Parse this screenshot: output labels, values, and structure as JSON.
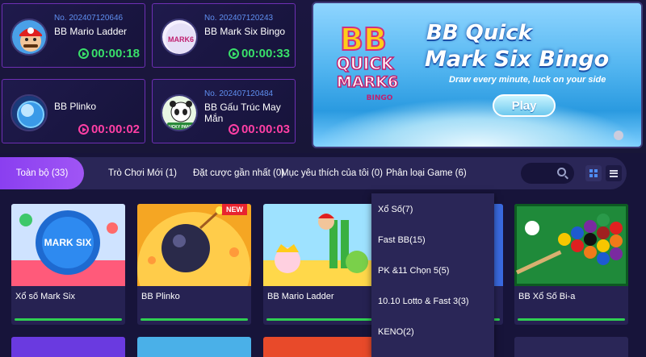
{
  "draws": [
    {
      "no": "No. 202407120646",
      "name": "BB Mario Ladder",
      "timer": "00:00:18",
      "status": "green"
    },
    {
      "no": "No. 202407120243",
      "name": "BB Mark Six Bingo",
      "timer": "00:00:33",
      "status": "green"
    },
    {
      "no": "",
      "name": "BB Plinko",
      "timer": "00:00:02",
      "status": "pink"
    },
    {
      "no": "No. 202407120484",
      "name": "BB Gấu Trúc May Mắn",
      "timer": "00:00:03",
      "status": "pink"
    }
  ],
  "banner": {
    "title_line1": "BB Quick",
    "title_line2": "Mark Six Bingo",
    "subtitle": "Draw every minute, luck on your side",
    "play": "Play",
    "logo_line1": "BB",
    "logo_line2": "QUICK",
    "logo_line3": "MARK6",
    "logo_line4": "BINGO"
  },
  "tabs": [
    {
      "label": "Toàn bộ (33)"
    },
    {
      "label": "Trò Chơi Mới (1)"
    },
    {
      "label": "Đặt cược gần nhất (0)"
    },
    {
      "label": "Mục yêu thích của tôi (0)"
    },
    {
      "label": "Phân loại Game (6)"
    }
  ],
  "games": [
    {
      "name": "Xổ số Mark Six",
      "thumb_text": "MARK SIX"
    },
    {
      "name": "BB Plinko",
      "badge": "NEW"
    },
    {
      "name": "BB Mario Ladder"
    },
    {
      "name": ""
    },
    {
      "name": "BB Xổ Số Bi-a"
    }
  ],
  "dropdown": [
    {
      "label": "Xổ Số(7)"
    },
    {
      "label": "Fast BB(15)"
    },
    {
      "label": "PK &11 Chọn 5(5)"
    },
    {
      "label": "10.10 Lotto & Fast 3(3)"
    },
    {
      "label": "KENO(2)"
    }
  ],
  "avatar_texts": {
    "mark6": "MARK6",
    "panda": "LUCKY PANDA"
  },
  "colors": {
    "background": "#17143a",
    "card_border": "#6e2fb4",
    "active_tab": "#8a3ff0",
    "timer_green": "#39e06a",
    "timer_pink": "#ff3fa4",
    "draw_no": "#5f8ff0",
    "progress": "#2fd052"
  }
}
